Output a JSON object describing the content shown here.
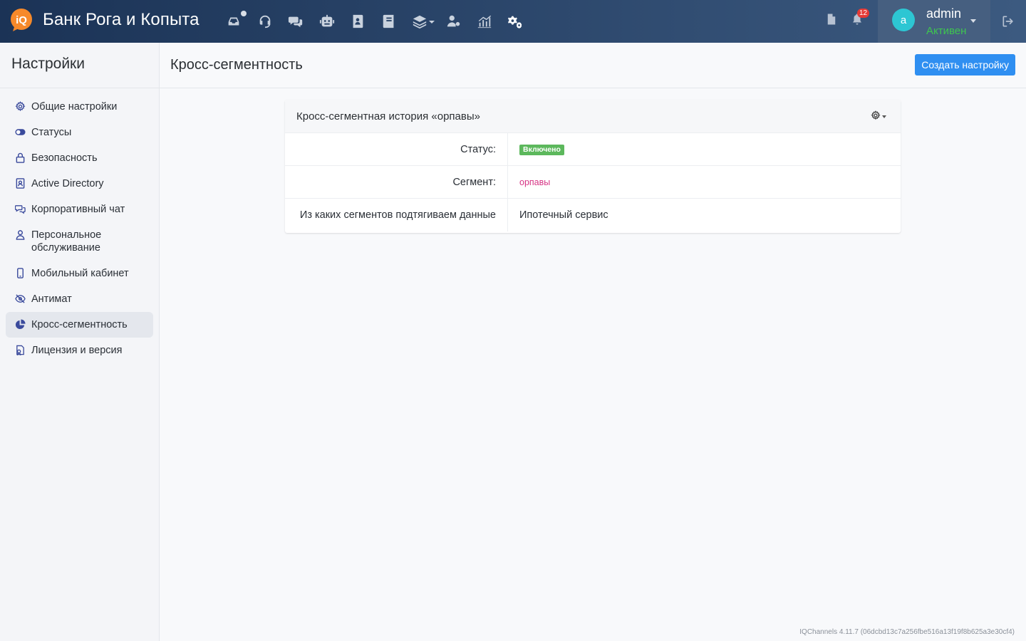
{
  "app": {
    "brand": "Банк Рога и Копыта",
    "logo_text": "iQ",
    "notifications_count": "12",
    "user_name": "admin",
    "user_initial": "a",
    "user_status": "Активен"
  },
  "nav_icons": [
    "inbox-icon",
    "headset-icon",
    "chat-icon",
    "robot-icon",
    "contacts-icon",
    "book-icon",
    "layers-icon",
    "user-settings-icon",
    "analytics-icon",
    "settings-icon"
  ],
  "sidebar": {
    "title": "Настройки",
    "items": [
      {
        "label": "Общие настройки",
        "icon": "gear-icon"
      },
      {
        "label": "Статусы",
        "icon": "toggle-icon"
      },
      {
        "label": "Безопасность",
        "icon": "lock-icon"
      },
      {
        "label": "Active Directory",
        "icon": "contact-card-icon"
      },
      {
        "label": "Корпоративный чат",
        "icon": "chat-icon"
      },
      {
        "label": "Персональное обслуживание",
        "icon": "user-icon"
      },
      {
        "label": "Мобильный кабинет",
        "icon": "phone-icon"
      },
      {
        "label": "Антимат",
        "icon": "eye-slash-icon"
      },
      {
        "label": "Кросс-сегментность",
        "icon": "pie-icon"
      },
      {
        "label": "Лицензия и версия",
        "icon": "license-icon"
      }
    ],
    "active_index": 8
  },
  "page": {
    "title": "Кросс-сегментность",
    "create_button": "Создать настройку"
  },
  "card": {
    "title": "Кросс-сегментная история «орпавы»",
    "rows": [
      {
        "label": "Статус:",
        "value": "Включено"
      },
      {
        "label": "Сегмент:",
        "value": "орпавы"
      },
      {
        "label": "Из каких сегментов подтягиваем данные",
        "value": "Ипотечный сервис"
      }
    ]
  },
  "footer": {
    "version": "IQChannels 4.11.7 (06dcbd13c7a256fbe516a13f19f8b625a3e30cf4)"
  },
  "colors": {
    "accent": "#2f8ff1",
    "status_success": "#5cb85c",
    "segment_pink": "#d63384",
    "active_green": "#3ec64f",
    "sidebar_icon": "#3a4a9c"
  }
}
